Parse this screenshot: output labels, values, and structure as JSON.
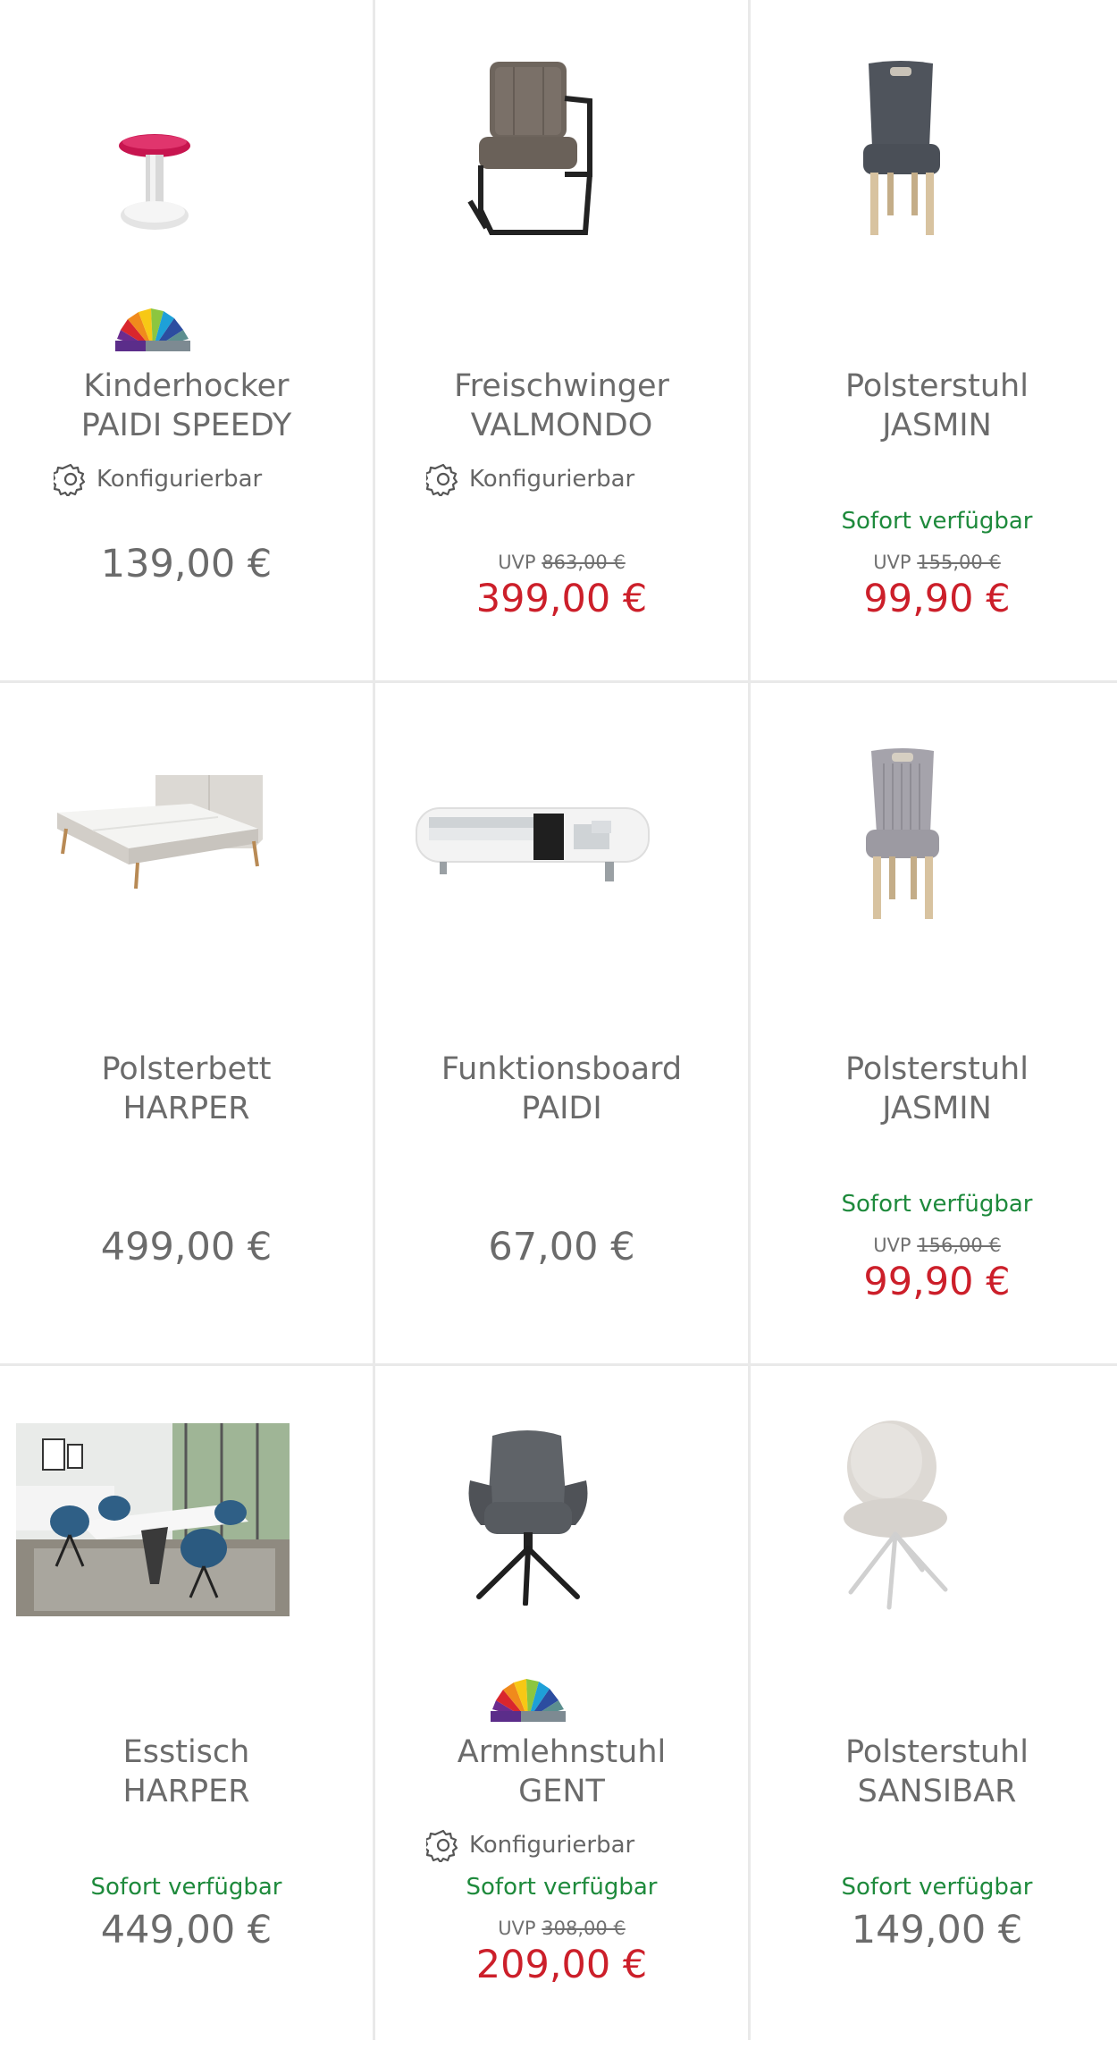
{
  "products": [
    {
      "line1": "Kinderhocker",
      "line2": "PAIDI SPEEDY",
      "config": "Konfigurierbar",
      "price": "139,00 €"
    },
    {
      "line1": "Freischwinger",
      "line2": "VALMONDO",
      "config": "Konfigurierbar",
      "uvp_label": "UVP",
      "uvp": "863,00 €",
      "price": "399,00 €"
    },
    {
      "line1": "Polsterstuhl",
      "line2": "JASMIN",
      "availability": "Sofort verfügbar",
      "uvp_label": "UVP",
      "uvp": "155,00 €",
      "price": "99,90 €"
    },
    {
      "line1": "Polsterbett",
      "line2": "HARPER",
      "price": "499,00 €"
    },
    {
      "line1": "Funktionsboard",
      "line2": "PAIDI",
      "price": "67,00 €"
    },
    {
      "line1": "Polsterstuhl",
      "line2": "JASMIN",
      "availability": "Sofort verfügbar",
      "uvp_label": "UVP",
      "uvp": "156,00 €",
      "price": "99,90 €"
    },
    {
      "line1": "Esstisch",
      "line2": "HARPER",
      "availability": "Sofort verfügbar",
      "price": "449,00 €"
    },
    {
      "line1": "Armlehnstuhl",
      "line2": "GENT",
      "config": "Konfigurierbar",
      "availability": "Sofort verfügbar",
      "uvp_label": "UVP",
      "uvp": "308,00 €",
      "price": "209,00 €"
    },
    {
      "line1": "Polsterstuhl",
      "line2": "SANSIBAR",
      "availability": "Sofort verfügbar",
      "price": "149,00 €"
    }
  ],
  "icons": {
    "config": "gear-icon",
    "swatch": "color-fan-icon"
  },
  "colors": {
    "sale_price": "#cc1f2a",
    "availability": "#1e8a3c",
    "regular_price": "#6b6b6b"
  }
}
